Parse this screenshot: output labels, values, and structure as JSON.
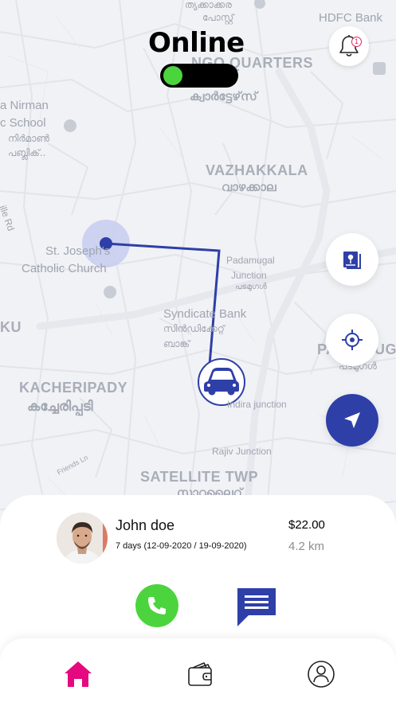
{
  "header": {
    "status_title": "Online",
    "online_toggle": true,
    "notification_count": "1"
  },
  "map": {
    "labels": {
      "top_ml_1": "ത്യക്കാക്കര",
      "top_ml_2": "പോസ്റ്റ്",
      "ngo_quarters": "NGO QUARTERS",
      "ngo_quarters_ml": "ക്വാർട്ടേഴ്‌സ്",
      "hdfc": "HDFC Bank",
      "nirman": "a Nirman",
      "school": "c School",
      "nirman_ml_1": "നിർമാൺ",
      "nirman_ml_2": "പബ്ലിക്..",
      "vazhakkala": "VAZHAKKALA",
      "vazhakkala_ml": "വാഴക്കാല",
      "rd": "ille Rd",
      "st_josephs_1": "St. Joseph's",
      "st_josephs_2": "Catholic Church",
      "padamugal_1": "Padamugal",
      "padamugal_2": "Junction",
      "padamugal_ml": "പടമുഗൾ",
      "syndicate": "Syndicate Bank",
      "syndicate_ml_1": "സിൻഡിക്കേറ്റ്",
      "syndicate_ml_2": "ബാങ്ക്",
      "ku": "KU",
      "pa": "PA",
      "ug": "UG",
      "padamugal_ml_right": "പടമുഗൾ",
      "kacheripady": "KACHERIPADY",
      "kacheripady_ml": "കച്ചേരിപ്പടി",
      "indira": "Indira junction",
      "rajiv": "Rajiv Junction",
      "friends_ln": "Friends Ln",
      "satellite": "SATELLITE TWP",
      "satellite_ml": "സാറ്റലൈറ്റ്"
    }
  },
  "actions": {
    "map_layers_icon": "map-layers-icon",
    "locate_icon": "crosshair-icon",
    "navigate_icon": "navigation-arrow-icon"
  },
  "driver": {
    "name": "John doe",
    "dates": "7 days (12-09-2020 / 19-09-2020)",
    "price": "$22.00",
    "distance": "4.2 km"
  },
  "tabs": [
    {
      "name": "home",
      "active": true
    },
    {
      "name": "wallet",
      "active": false
    },
    {
      "name": "profile",
      "active": false
    }
  ],
  "colors": {
    "accent_blue": "#2e3fa8",
    "online_green": "#4cd43e",
    "home_pink": "#e5087e",
    "notification_red": "#e0245e"
  }
}
